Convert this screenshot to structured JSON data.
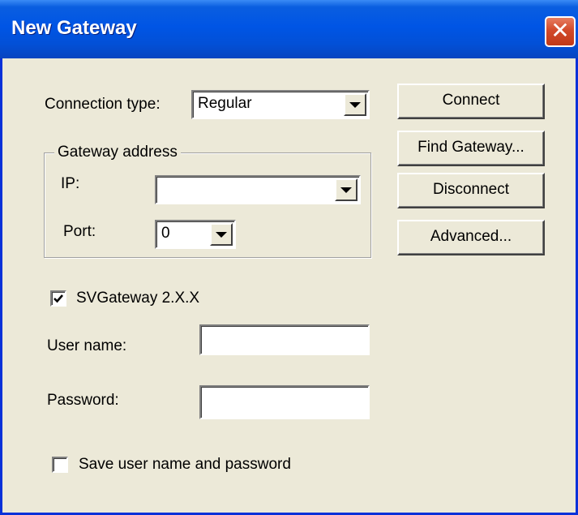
{
  "window": {
    "title": "New Gateway",
    "close_glyph": "✕",
    "colors": {
      "titlebar": "#0055e5",
      "client": "#ece9d8",
      "close": "#d24a2a"
    }
  },
  "connection": {
    "label": "Connection type:",
    "value": "Regular"
  },
  "gateway_address": {
    "group_label": "Gateway address",
    "ip_label": "IP:",
    "ip_value": "",
    "port_label": "Port:",
    "port_value": "0"
  },
  "svgateway": {
    "label": "SVGateway 2.X.X",
    "checked": true
  },
  "credentials": {
    "user_label": "User name:",
    "user_value": "",
    "password_label": "Password:",
    "password_value": "",
    "save_label": "Save user name and password",
    "save_checked": false
  },
  "buttons": {
    "connect": "Connect",
    "find_gateway": "Find Gateway...",
    "disconnect": "Disconnect",
    "advanced": "Advanced..."
  }
}
